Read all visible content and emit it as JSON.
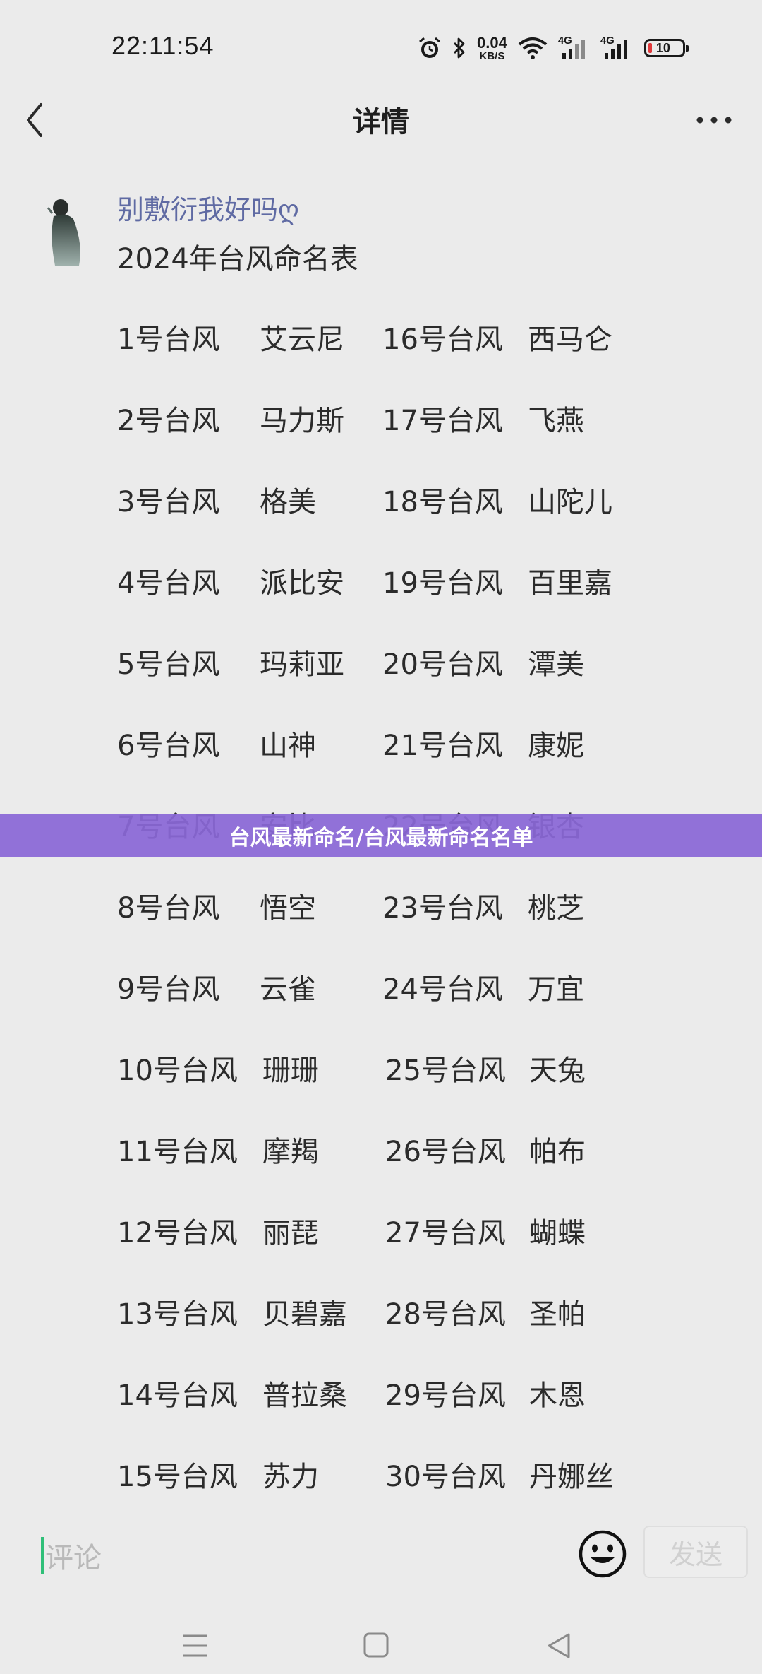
{
  "status_bar": {
    "time": "22:11:54",
    "net_speed_value": "0.04",
    "net_speed_unit": "KB/S",
    "signal1_label": "4G",
    "signal2_label": "4G",
    "battery_level": "10",
    "icons": [
      "alarm-icon",
      "bluetooth-icon",
      "wifi-icon",
      "signal-icon",
      "signal-icon",
      "battery-icon"
    ]
  },
  "header": {
    "title": "详情",
    "back_icon": "chevron-left-icon",
    "more_icon": "more-horizontal-icon"
  },
  "post": {
    "author": "别敷衍我好吗ღ",
    "title": "2024年台风命名表",
    "typhoons": [
      {
        "left_no": "1号台风",
        "left_name": "艾云尼",
        "right_no": "16号台风",
        "right_name": "西马仑"
      },
      {
        "left_no": "2号台风",
        "left_name": "马力斯",
        "right_no": "17号台风",
        "right_name": "飞燕"
      },
      {
        "left_no": "3号台风",
        "left_name": "格美",
        "right_no": "18号台风",
        "right_name": "山陀儿"
      },
      {
        "left_no": "4号台风",
        "left_name": "派比安",
        "right_no": "19号台风",
        "right_name": "百里嘉"
      },
      {
        "left_no": "5号台风",
        "left_name": "玛莉亚",
        "right_no": "20号台风",
        "right_name": "潭美"
      },
      {
        "left_no": "6号台风",
        "left_name": "山神",
        "right_no": "21号台风",
        "right_name": "康妮"
      },
      {
        "left_no": "7号台风",
        "left_name": "安比",
        "right_no": "22号台风",
        "right_name": "银杏"
      },
      {
        "left_no": "8号台风",
        "left_name": "悟空",
        "right_no": "23号台风",
        "right_name": "桃芝"
      },
      {
        "left_no": "9号台风",
        "left_name": "云雀",
        "right_no": "24号台风",
        "right_name": "万宜"
      },
      {
        "left_no": "10号台风",
        "left_name": "珊珊",
        "right_no": "25号台风",
        "right_name": "天兔"
      },
      {
        "left_no": "11号台风",
        "left_name": "摩羯",
        "right_no": "26号台风",
        "right_name": "帕布"
      },
      {
        "left_no": "12号台风",
        "left_name": "丽琵",
        "right_no": "27号台风",
        "right_name": "蝴蝶"
      },
      {
        "left_no": "13号台风",
        "left_name": "贝碧嘉",
        "right_no": "28号台风",
        "right_name": "圣帕"
      },
      {
        "left_no": "14号台风",
        "left_name": "普拉桑",
        "right_no": "29号台风",
        "right_name": "木恩"
      },
      {
        "left_no": "15号台风",
        "left_name": "苏力",
        "right_no": "30号台风",
        "right_name": "丹娜丝"
      }
    ]
  },
  "banner": {
    "text": "台风最新命名/台风最新命名名单"
  },
  "comment_bar": {
    "placeholder": "评论",
    "emoji_icon": "smiley-icon",
    "send_label": "发送"
  },
  "nav_bar": {
    "icons": [
      "menu-icon",
      "home-square-icon",
      "back-triangle-icon"
    ]
  },
  "colors": {
    "background": "#ebebeb",
    "author": "#5f6aa3",
    "banner": "#8a67d6",
    "caret": "#2fbf78",
    "battery_low": "#e0393b"
  }
}
